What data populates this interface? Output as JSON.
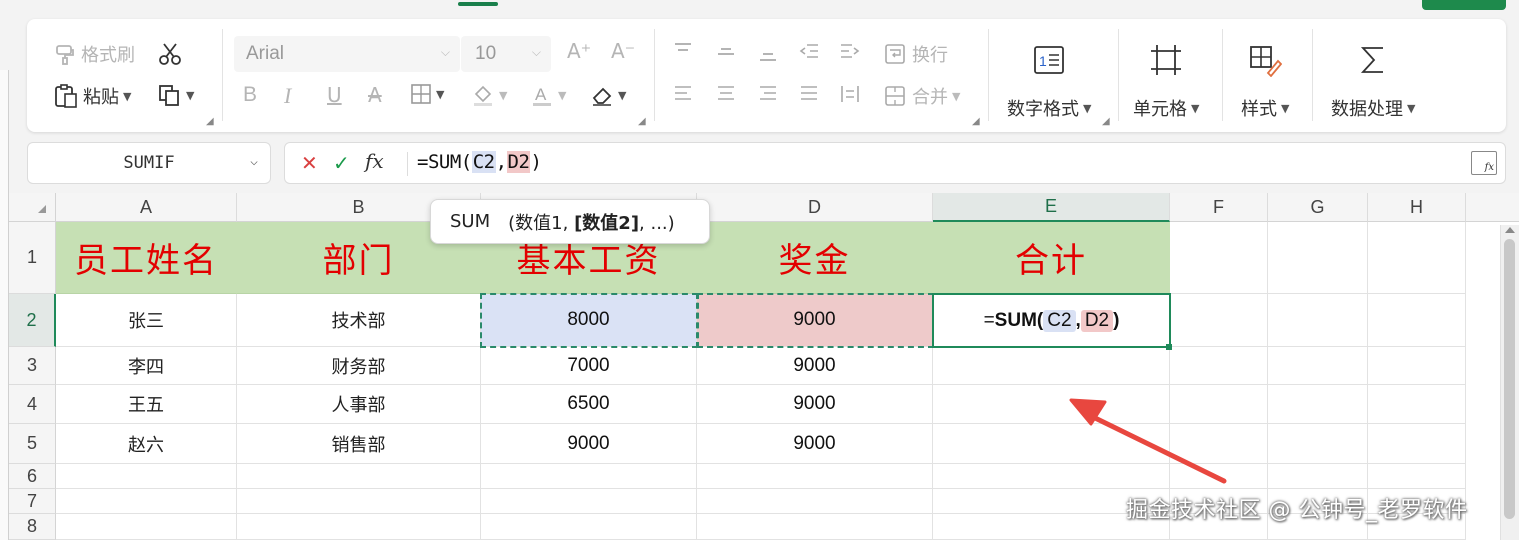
{
  "ribbon": {
    "format_painter": "格式刷",
    "paste": "粘贴",
    "font_name": "Arial",
    "font_size": "10",
    "wrap": "换行",
    "merge": "合并",
    "number_format": "数字格式",
    "cell": "单元格",
    "style": "样式",
    "data_process": "数据处理"
  },
  "formula_bar": {
    "name_box": "SUMIF",
    "prefix": "=SUM(",
    "ref1": "C2",
    "comma": ",",
    "ref2": "D2",
    "suffix": ")",
    "fx_label": "fx"
  },
  "tooltip": {
    "func": "SUM",
    "open": "(数值1, ",
    "bold": "[数值2]",
    "rest": ", ...)"
  },
  "columns": [
    "A",
    "B",
    "C",
    "D",
    "E",
    "F",
    "G",
    "H"
  ],
  "rows": [
    "1",
    "2",
    "3",
    "4",
    "5",
    "6",
    "7",
    "8"
  ],
  "table": {
    "headers": [
      "员工姓名",
      "部门",
      "基本工资",
      "奖金",
      "合计"
    ],
    "data": [
      [
        "张三",
        "技术部",
        "8000",
        "9000"
      ],
      [
        "李四",
        "财务部",
        "7000",
        "9000"
      ],
      [
        "王五",
        "人事部",
        "6500",
        "9000"
      ],
      [
        "赵六",
        "销售部",
        "9000",
        "9000"
      ]
    ]
  },
  "active_cell": {
    "prefix": "=",
    "func": "SUM(",
    "ref1": "C2",
    "comma": ",",
    "ref2": "D2",
    "suffix": ")"
  },
  "watermark": "掘金技术社区 @ 公钟号_老罗软件",
  "colors": {
    "header_fill": "#c6e0b4",
    "header_text": "#e30000",
    "ref_c": "#d9e1f4",
    "ref_d": "#f2c8c8",
    "accent": "#1f8a5a",
    "arrow": "#e8473f"
  }
}
